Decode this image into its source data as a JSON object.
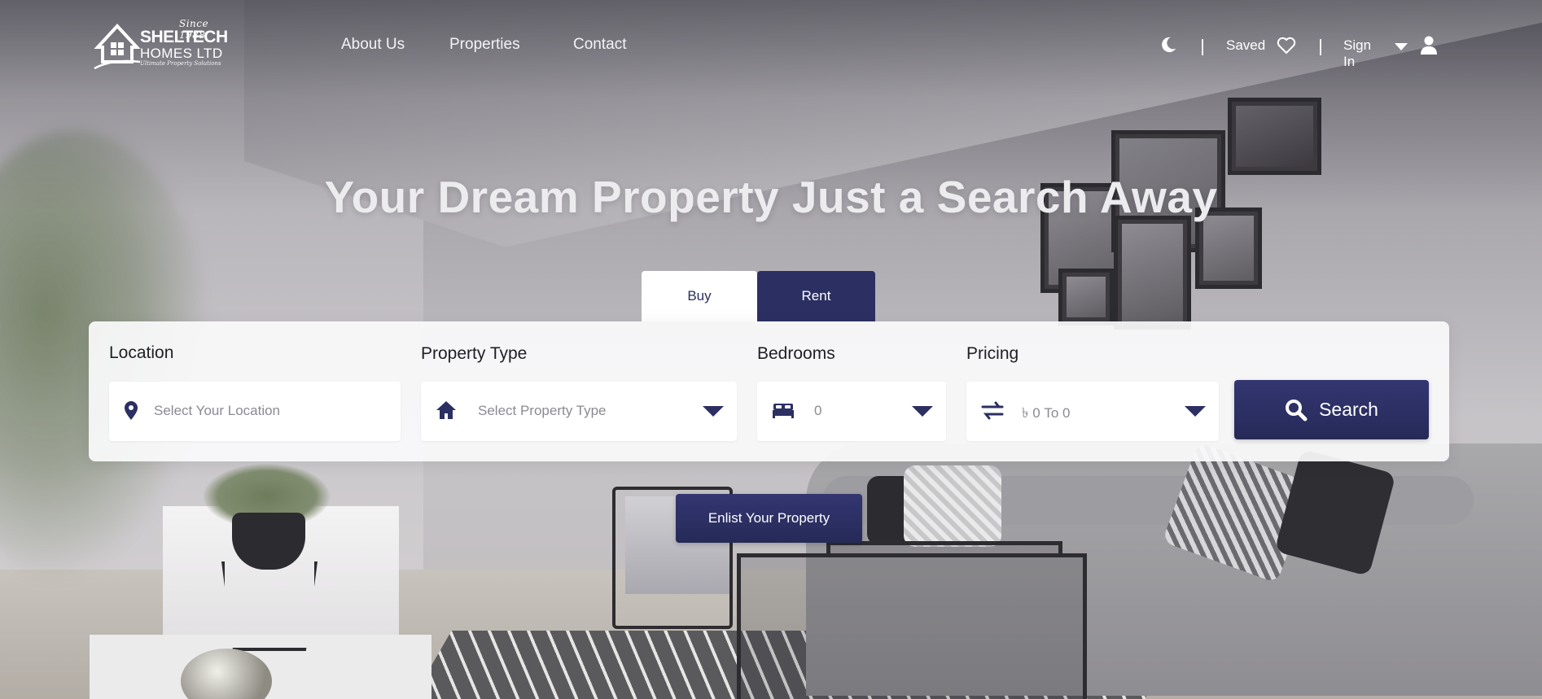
{
  "brand": {
    "since": "Since 1988",
    "name_line1": "SHELTECH",
    "name_line2": "HOMES LTD",
    "tagline": "Ultimate Property Solutions"
  },
  "nav": {
    "about": "About Us",
    "properties": "Properties",
    "contact": "Contact"
  },
  "header_right": {
    "theme_icon": "moon-icon",
    "saved_label": "Saved",
    "saved_icon": "heart-icon",
    "signin_label": "Sign In",
    "signin_caret_icon": "caret-down-icon",
    "user_icon": "user-icon"
  },
  "hero": {
    "headline": "Your Dream Property Just a Search Away"
  },
  "tabs": [
    {
      "label": "Buy",
      "active": true
    },
    {
      "label": "Rent",
      "active": false
    }
  ],
  "search": {
    "location": {
      "label": "Location",
      "placeholder": "Select Your Location",
      "icon": "map-pin-icon"
    },
    "property_type": {
      "label": "Property Type",
      "placeholder": "Select Property Type",
      "icon": "home-icon"
    },
    "bedrooms": {
      "label": "Bedrooms",
      "value": "0",
      "icon": "bed-icon"
    },
    "pricing": {
      "label": "Pricing",
      "value": "৳ 0 To 0",
      "icon": "swap-arrows-icon"
    },
    "button_label": "Search",
    "button_icon": "search-icon"
  },
  "enlist_label": "Enlist Your Property",
  "colors": {
    "accent": "#2c2f62",
    "white": "#ffffff",
    "headline": "#ecebee"
  }
}
